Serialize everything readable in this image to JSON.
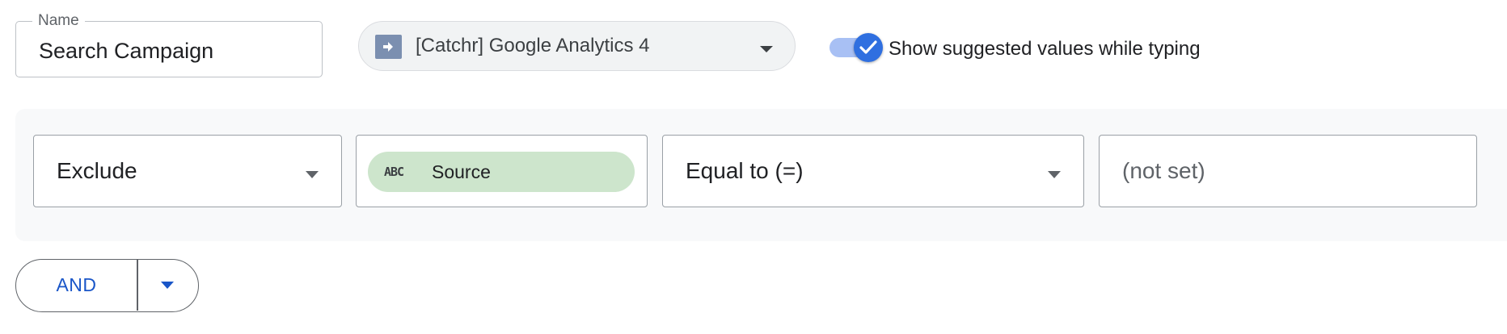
{
  "name_field": {
    "legend": "Name",
    "value": "Search Campaign"
  },
  "data_source": {
    "label": "[Catchr] Google Analytics 4",
    "icon": "arrow-right-icon"
  },
  "suggest_toggle": {
    "label": "Show suggested values while typing",
    "checked": true
  },
  "condition": {
    "mode": "Exclude",
    "dimension": {
      "type_badge": "ABC",
      "label": "Source"
    },
    "operator": "Equal to (=)",
    "value": "(not set)"
  },
  "and_button": {
    "label": "AND"
  },
  "colors": {
    "accent": "#1a56c8",
    "toggle_knob": "#2f6fe0",
    "toggle_track": "#a8c0f4",
    "chip_bg": "#cde5cc",
    "panel_bg": "#f8f9fa",
    "source_icon_bg": "#7b8fb0"
  }
}
